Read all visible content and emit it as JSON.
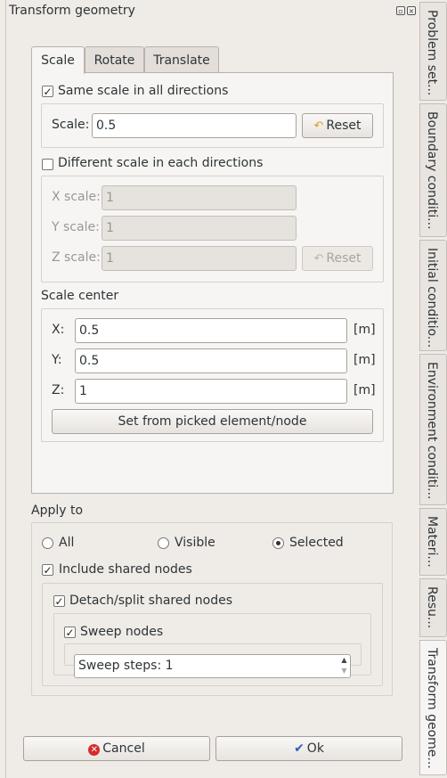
{
  "window": {
    "title": "Transform geometry"
  },
  "tabs": {
    "scale": "Scale",
    "rotate": "Rotate",
    "translate": "Translate"
  },
  "scale": {
    "same_label": "Same scale in all directions",
    "scale_label": "Scale:",
    "scale_value": "0.5",
    "reset": "Reset",
    "different_label": "Different scale in each directions",
    "x_label": "X scale:",
    "x_value": "1",
    "y_label": "Y scale:",
    "y_value": "1",
    "z_label": "Z scale:",
    "z_value": "1",
    "center_title": "Scale center",
    "cx_label": "X:",
    "cx_value": "0.5",
    "cy_label": "Y:",
    "cy_value": "0.5",
    "cz_label": "Z:",
    "cz_value": "1",
    "unit": "[m]",
    "set_from_picked": "Set from picked element/node"
  },
  "apply": {
    "title": "Apply to",
    "all": "All",
    "visible": "Visible",
    "selected": "Selected",
    "include_shared": "Include shared nodes",
    "detach_split": "Detach/split shared nodes",
    "sweep_nodes": "Sweep nodes",
    "sweep_steps": "Sweep steps: 1"
  },
  "footer": {
    "cancel": "Cancel",
    "ok": "Ok"
  },
  "side_tabs": {
    "problem": "Problem set...",
    "boundary": "Boundary conditi...",
    "initial": "Initial conditio...",
    "environment": "Environment conditi...",
    "materials": "Materi...",
    "results": "Resu...",
    "transform": "Transform geome..."
  }
}
